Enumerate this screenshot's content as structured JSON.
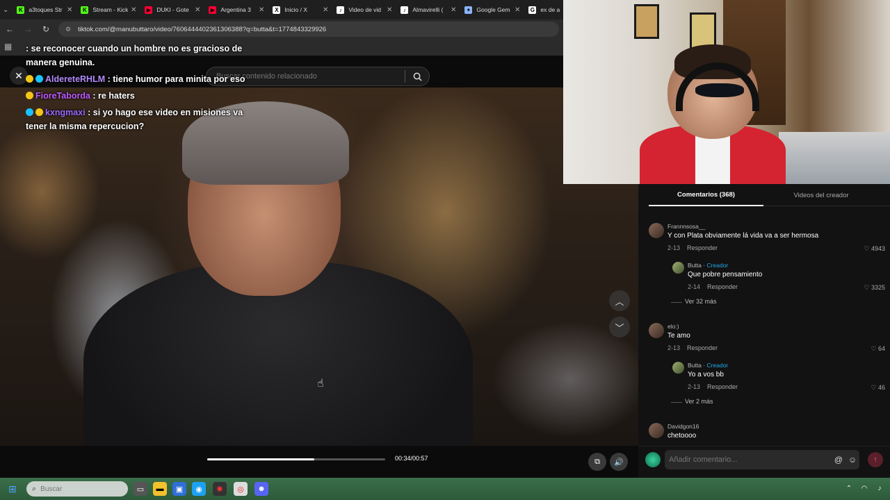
{
  "browser": {
    "tabs": [
      {
        "title": "a3toques Str",
        "fav": "K",
        "fav_color": "#53fc18"
      },
      {
        "title": "Stream - Kick",
        "fav": "K",
        "fav_color": "#53fc18"
      },
      {
        "title": "DUKI - Gote",
        "fav": "▶",
        "fav_color": "#ff0033"
      },
      {
        "title": "Argentina 3",
        "fav": "▶",
        "fav_color": "#ff0033"
      },
      {
        "title": "Inicio / X",
        "fav": "X",
        "fav_color": "#ffffff"
      },
      {
        "title": "Video de vid",
        "fav": "♪",
        "fav_color": "#ffffff"
      },
      {
        "title": "Almavirelli (",
        "fav": "♪",
        "fav_color": "#ffffff"
      },
      {
        "title": "Google Gem",
        "fav": "✦",
        "fav_color": "#8ab4f8"
      },
      {
        "title": "ex de a",
        "fav": "G",
        "fav_color": "#ffffff"
      }
    ],
    "url": "tiktok.com/@manubuttaro/video/7606444402361306388?q=butta&t=1774843329926"
  },
  "video": {
    "search_placeholder": "Buscar contenido relacionado",
    "time": "00:34/00:57",
    "progress": 0.6
  },
  "chat": [
    {
      "user": "",
      "text": ": se reconocer cuando un hombre no es gracioso de manera genuina.",
      "color": "#ff4d6d",
      "badges": []
    },
    {
      "user": "AldereteRHLM",
      "text": " : tiene humor para minita por eso",
      "color": "#b38bff",
      "badges": [
        "#f5c518",
        "#19c3ff"
      ]
    },
    {
      "user": "FioreTaborda",
      "text": " : re haters",
      "color": "#c05cff",
      "badges": [
        "#f5c518"
      ]
    },
    {
      "user": "kxngmaxi",
      "text": " : si yo hago ese video en misiones va tener la misma repercucion?",
      "color": "#9b6bff",
      "badges": [
        "#19c3ff",
        "#f5c518"
      ]
    }
  ],
  "panel": {
    "tab_comments": "Comentarios (368)",
    "tab_creator_videos": "Videos del creador",
    "reply_label": "Responder",
    "creator_label": "Creador",
    "comments": [
      {
        "user": "Frannnsosa__",
        "text": "Y con Plata obviamente lá vida va a ser hermosa",
        "date": "2-13",
        "likes": "4943"
      },
      {
        "user": "Butta",
        "creator": true,
        "text": "Que pobre pensamiento",
        "date": "2-14",
        "likes": "3325"
      },
      {
        "more": "Ver 32 más"
      },
      {
        "user": "elo:)",
        "text": "Te amo",
        "date": "2-13",
        "likes": "64"
      },
      {
        "user": "Butta",
        "creator": true,
        "text": "Yo a vos bb",
        "date": "2-13",
        "likes": "46"
      },
      {
        "more": "Ver 2 más"
      },
      {
        "user": "Davidgon16",
        "text": "chetoooo",
        "date": "",
        "likes": ""
      }
    ],
    "input_placeholder": "Añadir comentario..."
  },
  "taskbar": {
    "search_placeholder": "Buscar"
  }
}
